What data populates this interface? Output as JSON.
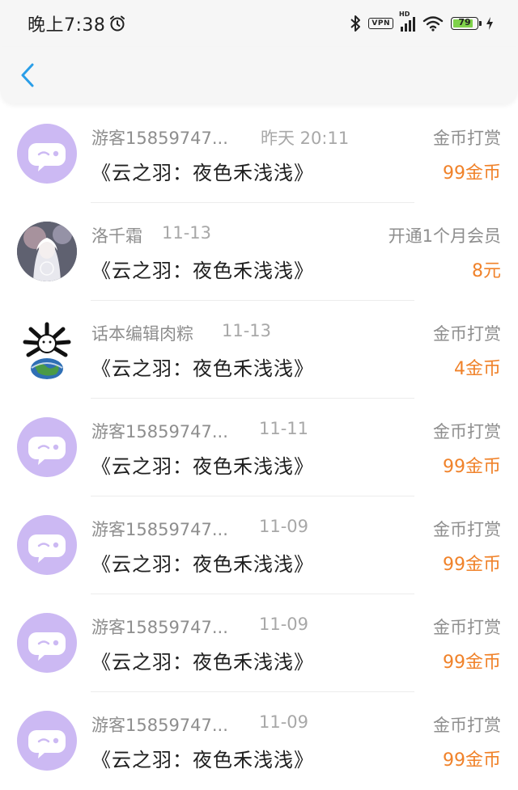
{
  "status_bar": {
    "time": "晚上7:38",
    "vpn": "VPN",
    "signal_label": "HD",
    "battery": "79"
  },
  "colors": {
    "accent_blue": "#2a9ee8",
    "amount_orange": "#f0822a",
    "guest_avatar": "#ccb9f3",
    "battery_green": "#7fd24a"
  },
  "records": [
    {
      "avatar": "guest",
      "name": "游客15859747...",
      "date": "昨天 20:11",
      "book": "《云之羽：夜色禾浅浅》",
      "type": "金币打赏",
      "amount": "99金币"
    },
    {
      "avatar": "photo",
      "name": "洛千霜",
      "date": "11-13",
      "book": "《云之羽：夜色禾浅浅》",
      "type": "开通1个月会员",
      "amount": "8元"
    },
    {
      "avatar": "globe",
      "name": "话本编辑肉粽",
      "date": "11-13",
      "book": "《云之羽：夜色禾浅浅》",
      "type": "金币打赏",
      "amount": "4金币"
    },
    {
      "avatar": "guest",
      "name": "游客15859747...",
      "date": "11-11",
      "book": "《云之羽：夜色禾浅浅》",
      "type": "金币打赏",
      "amount": "99金币"
    },
    {
      "avatar": "guest",
      "name": "游客15859747...",
      "date": "11-09",
      "book": "《云之羽：夜色禾浅浅》",
      "type": "金币打赏",
      "amount": "99金币"
    },
    {
      "avatar": "guest",
      "name": "游客15859747...",
      "date": "11-09",
      "book": "《云之羽：夜色禾浅浅》",
      "type": "金币打赏",
      "amount": "99金币"
    },
    {
      "avatar": "guest",
      "name": "游客15859747...",
      "date": "11-09",
      "book": "《云之羽：夜色禾浅浅》",
      "type": "金币打赏",
      "amount": "99金币"
    }
  ]
}
